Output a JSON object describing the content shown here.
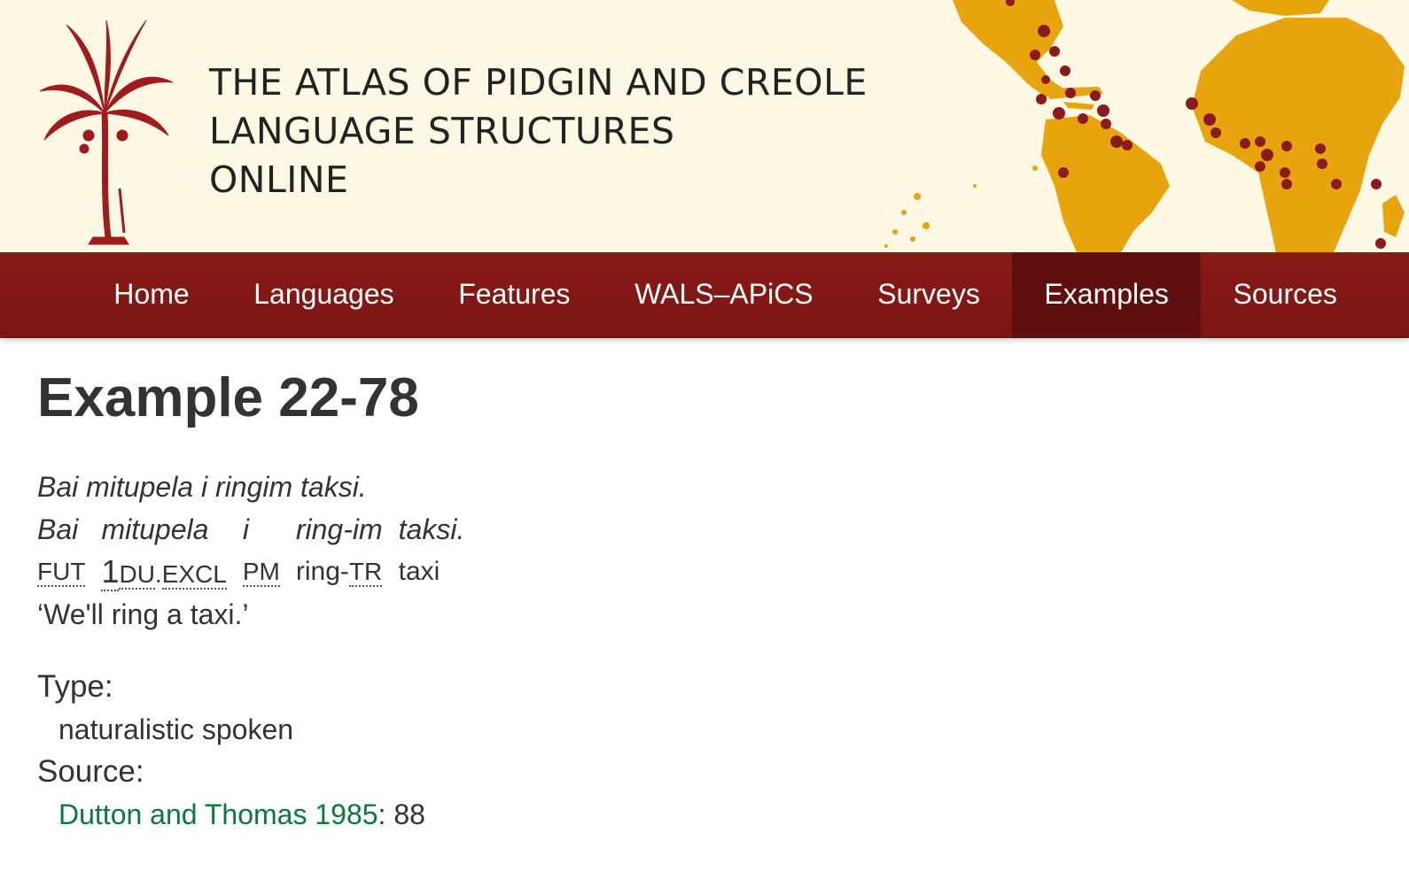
{
  "banner": {
    "title_lines": [
      "THE ATLAS OF PIDGIN AND CREOLE",
      "LANGUAGE STRUCTURES",
      "ONLINE"
    ],
    "map_land_color": "#e8a40c",
    "map_point_color": "#8b1a1a"
  },
  "nav": {
    "items": [
      {
        "label": "Home"
      },
      {
        "label": "Languages"
      },
      {
        "label": "Features"
      },
      {
        "label": "WALS–APiCS"
      },
      {
        "label": "Surveys"
      },
      {
        "label": "Examples",
        "active": true
      },
      {
        "label": "Sources"
      }
    ]
  },
  "page": {
    "title": "Example 22-78"
  },
  "example": {
    "text": "Bai mitupela i ringim taksi.",
    "words": [
      "Bai",
      "mitupela",
      "i",
      "ring-im",
      "taksi."
    ],
    "glosses": [
      {
        "abbr": "FUT"
      },
      {
        "num": "1",
        "abbr1": "DU",
        "sep": ".",
        "abbr2": "EXCL"
      },
      {
        "abbr": "PM"
      },
      {
        "plain": "ring-",
        "abbr": "TR"
      },
      {
        "plain": "taxi"
      }
    ],
    "translation": "‘We'll ring a taxi.’"
  },
  "meta": {
    "type_label": "Type:",
    "type_value": "naturalistic spoken",
    "source_label": "Source:",
    "source_link": "Dutton and Thomas 1985",
    "source_pages": ": 88"
  },
  "colors": {
    "nav_bg": "#7b1612",
    "nav_active_bg": "#5f100e",
    "link": "#0a7a3c",
    "banner_bg": "#fdf8e3"
  }
}
